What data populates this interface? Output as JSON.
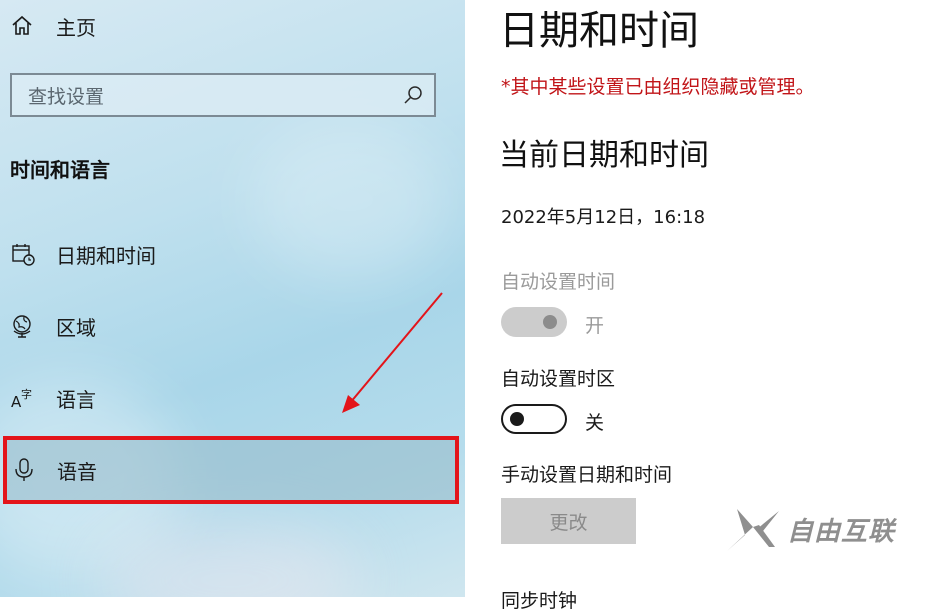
{
  "sidebar": {
    "home": {
      "label": "主页",
      "icon": "home-icon"
    },
    "search": {
      "placeholder": "查找设置",
      "icon": "search-icon"
    },
    "section_title": "时间和语言",
    "items": [
      {
        "label": "日期和时间",
        "icon": "calendar-clock-icon"
      },
      {
        "label": "区域",
        "icon": "globe-region-icon"
      },
      {
        "label": "语言",
        "icon": "language-icon"
      },
      {
        "label": "语音",
        "icon": "microphone-icon",
        "selected": true
      }
    ]
  },
  "main": {
    "title": "日期和时间",
    "notice": "*其中某些设置已由组织隐藏或管理。",
    "current_heading": "当前日期和时间",
    "current_datetime": "2022年5月12日，16:18",
    "auto_time": {
      "label": "自动设置时间",
      "state": "开",
      "on": true,
      "disabled": true
    },
    "auto_timezone": {
      "label": "自动设置时区",
      "state": "关",
      "on": false
    },
    "manual": {
      "label": "手动设置日期和时间",
      "button": "更改"
    },
    "sync_label_partial": "同步时钟"
  },
  "watermark": {
    "text": "自由互联"
  },
  "colors": {
    "highlight_border": "#e3141a",
    "notice": "#c11418",
    "arrow": "#e3141a"
  }
}
